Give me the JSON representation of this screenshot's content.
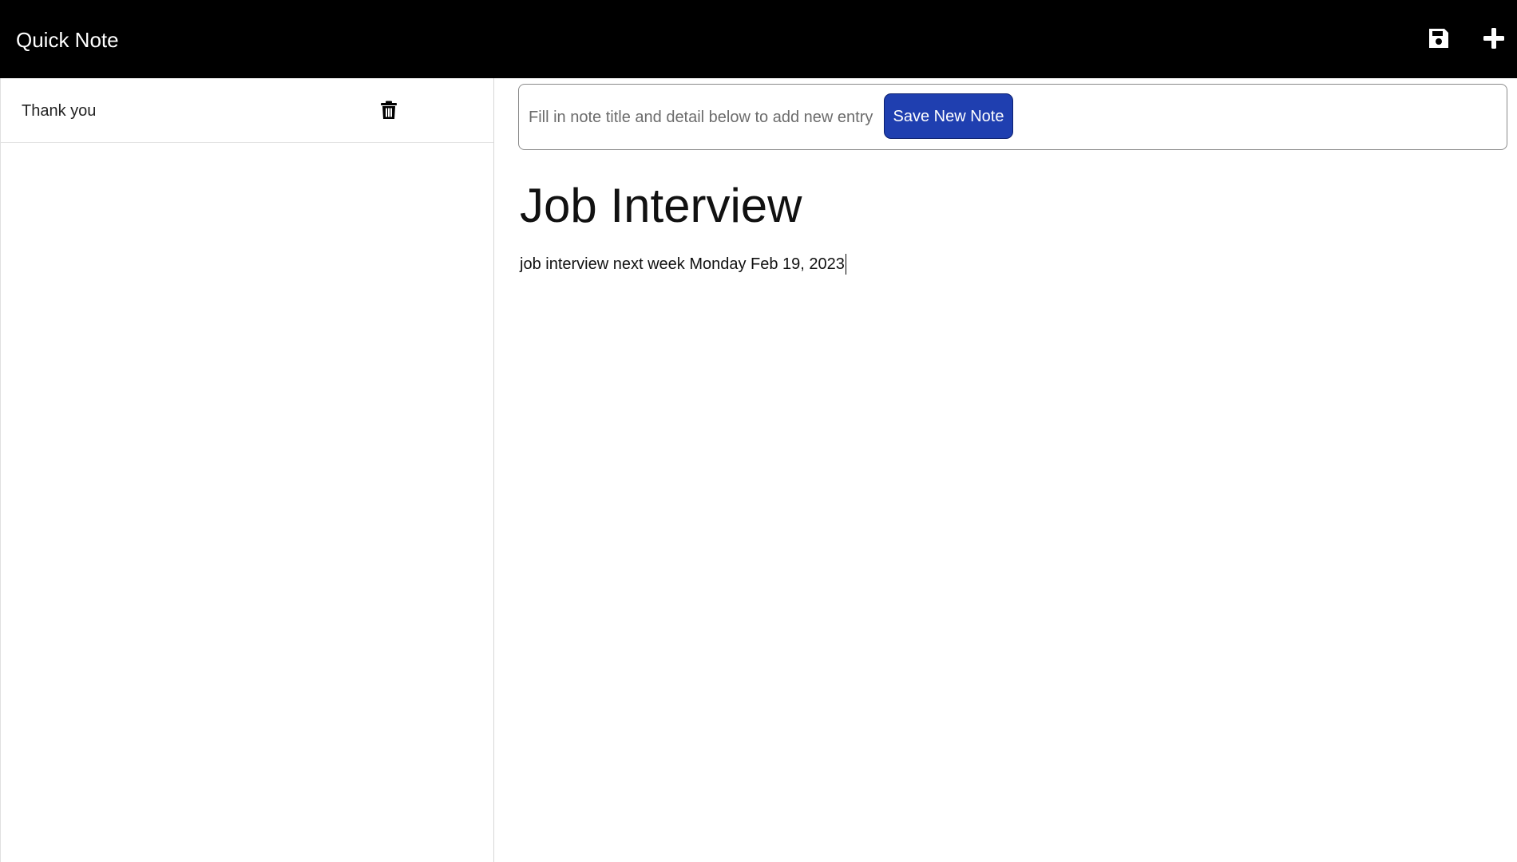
{
  "app": {
    "title": "Quick Note",
    "icons": {
      "save": "floppy-disk-icon",
      "add": "plus-icon"
    }
  },
  "sidebar": {
    "items": [
      {
        "label": "Thank you",
        "icon": "trash-icon"
      }
    ]
  },
  "main": {
    "new_entry_hint": "Fill in note title and detail below to add new entry",
    "save_new_label": "Save New Note",
    "note_title": "Job Interview",
    "note_body": "job interview next week Monday Feb 19, 2023"
  },
  "colors": {
    "topbar": "#000000",
    "button": "#1f3fb0"
  }
}
